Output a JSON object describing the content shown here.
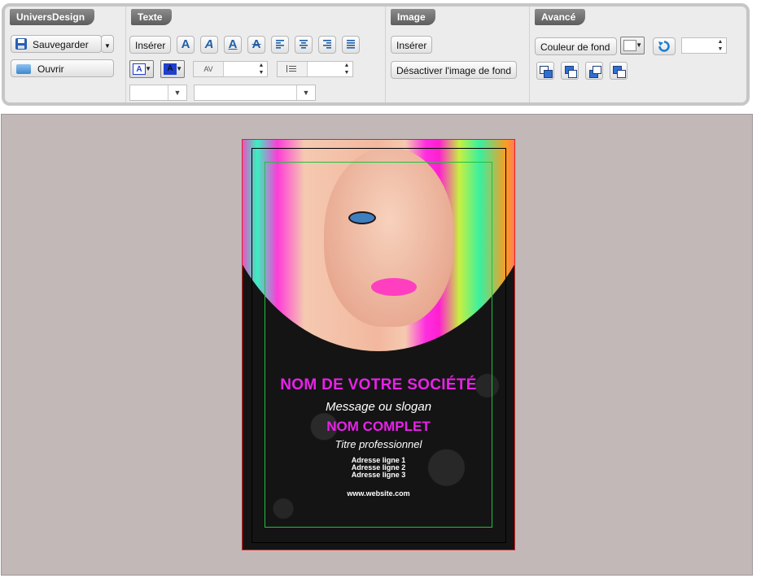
{
  "toolbar": {
    "groups": {
      "univers": {
        "title": "UniversDesign",
        "save_label": "Sauvegarder",
        "open_label": "Ouvrir"
      },
      "texte": {
        "title": "Texte",
        "insert_label": "Insérer",
        "char_spacing_icon": "AV"
      },
      "image": {
        "title": "Image",
        "insert_label": "Insérer",
        "disable_bg_label": "Désactiver l'image de fond"
      },
      "avance": {
        "title": "Avancé",
        "bg_color_label": "Couleur de fond"
      }
    }
  },
  "card": {
    "company": "NOM DE VOTRE SOCIÉTÉ",
    "slogan": "Message ou slogan",
    "full_name": "NOM COMPLET",
    "job_title": "Titre professionnel",
    "address": [
      "Adresse ligne 1",
      "Adresse ligne 2",
      "Adresse ligne 3"
    ],
    "website": "www.website.com"
  },
  "colors": {
    "accent_magenta": "#e822e8",
    "icon_blue": "#1f5fa8",
    "workspace_bg": "#c2b8b8"
  }
}
